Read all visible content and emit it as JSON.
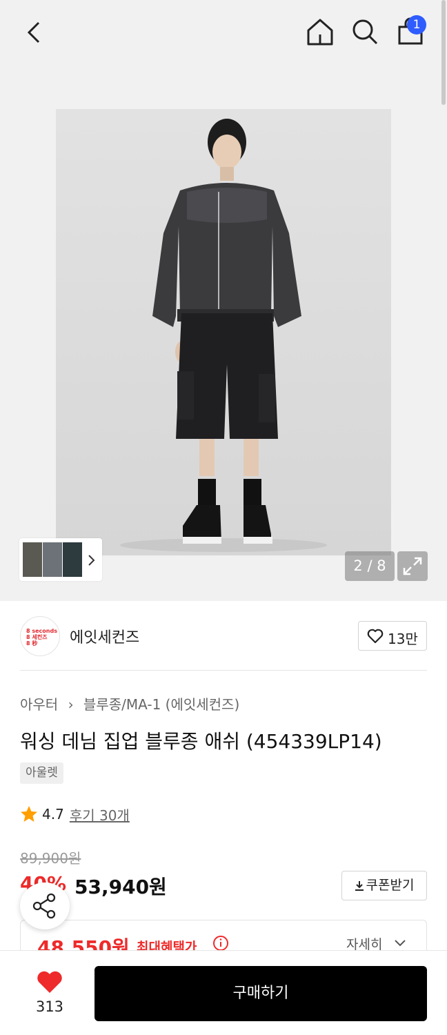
{
  "header": {
    "back_icon": "chevron-left-icon",
    "home_icon": "home-icon",
    "search_icon": "search-icon",
    "cart_icon": "shopping-bag-icon",
    "cart_badge": "1",
    "badge_color": "#2f5cff"
  },
  "gallery": {
    "counter": "2 / 8",
    "expand_icon": "expand-icon",
    "thumbnail_chevron_icon": "chevron-right-icon"
  },
  "brand": {
    "logo_text_lines": [
      "8 seconds",
      "8 세컨즈",
      "8 秒"
    ],
    "name": "에잇세컨즈",
    "like_count": "13만",
    "accent_color": "#e0282e"
  },
  "product": {
    "breadcrumb": [
      "아우터",
      "블루종/MA-1 (에잇세컨즈)"
    ],
    "title": "워싱 데님 집업 블루종 애쉬 (454339LP14)",
    "tag": "아울렛",
    "rating": "4.7",
    "review_link": "후기 30개",
    "original_price": "89,900원",
    "discount_rate": "40%",
    "sale_price": "53,940원",
    "coupon_label": "쿠폰받기",
    "benefit_price": "48,550원",
    "benefit_label": "최대혜택가",
    "detail_link": "자세히",
    "sale_color": "#ee2a2a"
  },
  "bottom_bar": {
    "wish_count": "313",
    "buy_label": "구매하기"
  }
}
